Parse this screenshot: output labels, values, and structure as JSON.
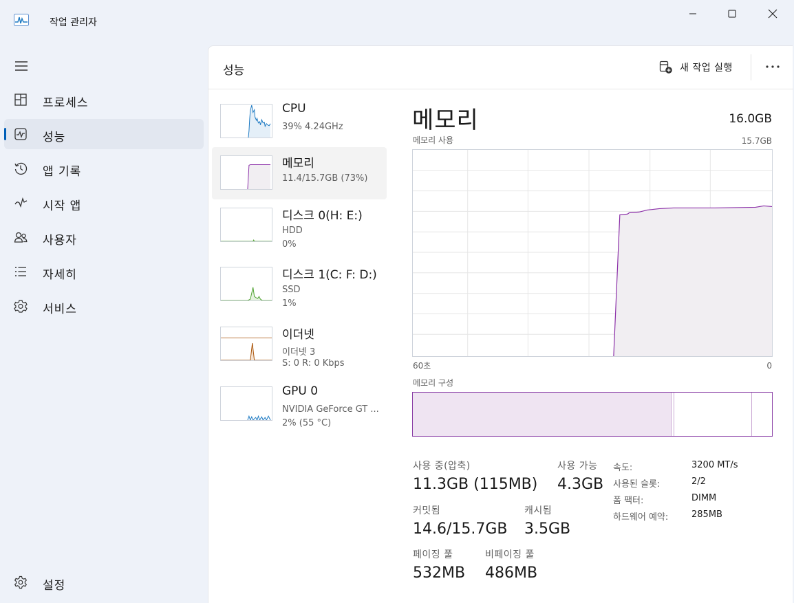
{
  "app": {
    "title": "작업 관리자"
  },
  "nav": {
    "items": [
      {
        "label": "프로세스",
        "icon": "processes-icon"
      },
      {
        "label": "성능",
        "icon": "performance-icon",
        "active": true
      },
      {
        "label": "앱 기록",
        "icon": "app-history-icon"
      },
      {
        "label": "시작 앱",
        "icon": "startup-apps-icon"
      },
      {
        "label": "사용자",
        "icon": "users-icon"
      },
      {
        "label": "자세히",
        "icon": "details-icon"
      },
      {
        "label": "서비스",
        "icon": "services-icon"
      }
    ],
    "settings": {
      "label": "설정",
      "icon": "settings-icon"
    }
  },
  "header": {
    "title": "성능",
    "run_task": "새 작업 실행"
  },
  "devices": [
    {
      "name": "CPU",
      "line1": "39% 4.24GHz",
      "line2": "",
      "color": "#1a78c2"
    },
    {
      "name": "메모리",
      "line1": "11.4/15.7GB (73%)",
      "line2": "",
      "color": "#8b2fa8",
      "active": true
    },
    {
      "name": "디스크 0(H: E:)",
      "line1": "HDD",
      "line2": "0%",
      "color": "#4ca02c"
    },
    {
      "name": "디스크 1(C: F: D:)",
      "line1": "SSD",
      "line2": "1%",
      "color": "#4ca02c"
    },
    {
      "name": "이더넷",
      "line1": "이더넷 3",
      "line2": "S: 0 R: 0 Kbps",
      "color": "#a74f01"
    },
    {
      "name": "GPU 0",
      "line1": "NVIDIA GeForce GT ...",
      "line2": "2% (55 °C)",
      "color": "#1a78c2"
    }
  ],
  "detail": {
    "title": "메모리",
    "total": "16.0GB",
    "usage_label": "메모리 사용",
    "usage_max": "15.7GB",
    "axis_left": "60초",
    "axis_right": "0",
    "composition_label": "메모리 구성",
    "composition": {
      "in_use_fraction": 0.72,
      "modified_fraction": 0.008,
      "standby_end_fraction": 0.945
    },
    "stats": {
      "in_use_label": "사용 중(압축)",
      "in_use_value": "11.3GB (115MB)",
      "available_label": "사용 가능",
      "available_value": "4.3GB",
      "committed_label": "커밋됨",
      "committed_value": "14.6/15.7GB",
      "cached_label": "캐시됨",
      "cached_value": "3.5GB",
      "paged_label": "페이징 풀",
      "paged_value": "532MB",
      "nonpaged_label": "비페이징 풀",
      "nonpaged_value": "486MB"
    },
    "props": [
      {
        "label": "속도:",
        "value": "3200 MT/s"
      },
      {
        "label": "사용된 슬롯:",
        "value": "2/2"
      },
      {
        "label": "폼 팩터:",
        "value": "DIMM"
      },
      {
        "label": "하드웨어 예약:",
        "value": "285MB"
      }
    ]
  },
  "colors": {
    "memory": "#8b2fa8",
    "memory_fill": "#f1eef2",
    "accent": "#005fb8"
  }
}
